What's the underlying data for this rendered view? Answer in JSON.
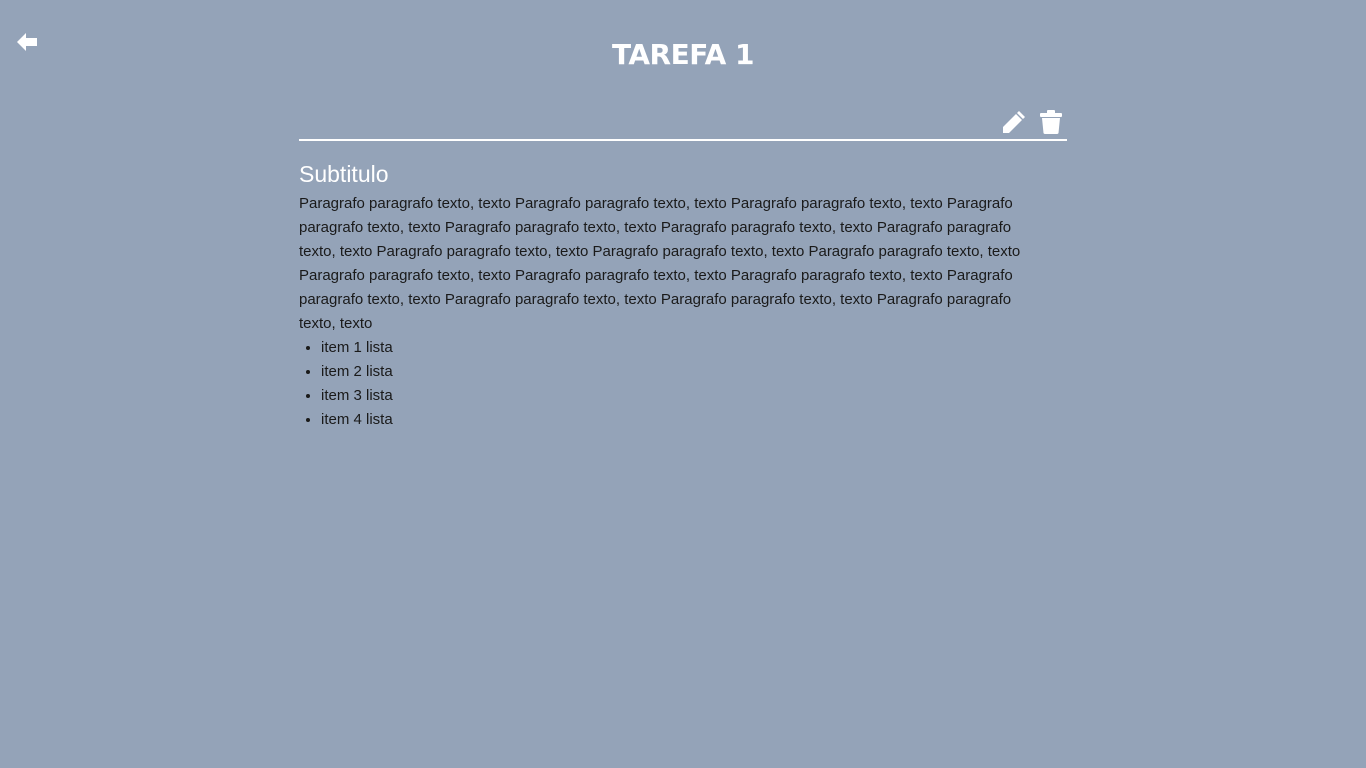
{
  "header": {
    "title": "TAREFA 1",
    "back_icon": "arrow-left-icon"
  },
  "toolbar": {
    "edit_icon": "pencil-icon",
    "delete_icon": "trash-icon"
  },
  "content": {
    "subtitle": "Subtitulo",
    "paragraph": "Paragrafo paragrafo texto, texto Paragrafo paragrafo texto, texto Paragrafo paragrafo texto, texto Paragrafo paragrafo texto, texto Paragrafo paragrafo texto, texto Paragrafo paragrafo texto, texto Paragrafo paragrafo texto, texto Paragrafo paragrafo texto, texto Paragrafo paragrafo texto, texto Paragrafo paragrafo texto, texto Paragrafo paragrafo texto, texto Paragrafo paragrafo texto, texto Paragrafo paragrafo texto, texto Paragrafo paragrafo texto, texto Paragrafo paragrafo texto, texto Paragrafo paragrafo texto, texto Paragrafo paragrafo texto, texto",
    "list_items": [
      "item 1 lista",
      "item 2 lista",
      "item 3 lista",
      "item 4 lista"
    ]
  },
  "colors": {
    "background": "#94a3b8",
    "title": "#ffffff",
    "text": "#1a1a1a",
    "divider": "#ffffff"
  }
}
